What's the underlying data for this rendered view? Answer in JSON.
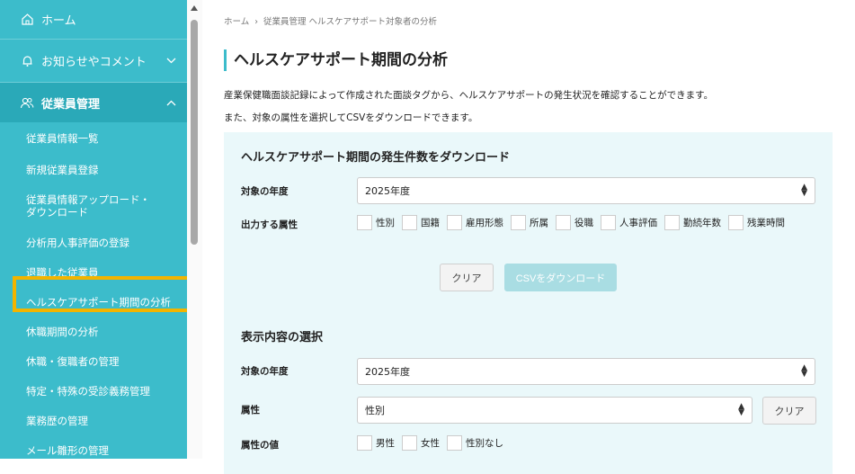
{
  "sidebar": {
    "home": "ホーム",
    "news": "お知らせやコメント",
    "employees": "従業員管理",
    "items": [
      "従業員情報一覧",
      "新規従業員登録",
      "従業員情報アップロード・ダウンロード",
      "分析用人事評価の登録",
      "退職した従業員",
      "ヘルスケアサポート期間の分析",
      "休職期間の分析",
      "休職・復職者の管理",
      "特定・特殊の受診義務管理",
      "業務歴の管理",
      "メール雛形の管理"
    ]
  },
  "breadcrumb": {
    "home": "ホーム",
    "sep": "›",
    "current": "従業員管理 ヘルスケアサポート対象者の分析"
  },
  "page": {
    "title": "ヘルスケアサポート期間の分析",
    "desc1": "産業保健職面談記録によって作成された面談タグから、ヘルスケアサポートの発生状況を確認することができます。",
    "desc2": "また、対象の属性を選択してCSVをダウンロードできます。"
  },
  "download": {
    "heading": "ヘルスケアサポート期間の発生件数をダウンロード",
    "year_label": "対象の年度",
    "year_value": "2025年度",
    "attr_label": "出力する属性",
    "attributes": [
      "性別",
      "国籍",
      "雇用形態",
      "所属",
      "役職",
      "人事評価",
      "勤続年数",
      "残業時間"
    ],
    "clear": "クリア",
    "csv": "CSVをダウンロード"
  },
  "display": {
    "heading": "表示内容の選択",
    "year_label": "対象の年度",
    "year_value": "2025年度",
    "attr_label": "属性",
    "attr_value": "性別",
    "clear": "クリア",
    "values_label": "属性の値",
    "values": [
      "男性",
      "女性",
      "性別なし"
    ]
  },
  "colors": {
    "sidebar": "#3cbccb",
    "highlight": "#f2b400",
    "panel": "#eaf8fa"
  }
}
